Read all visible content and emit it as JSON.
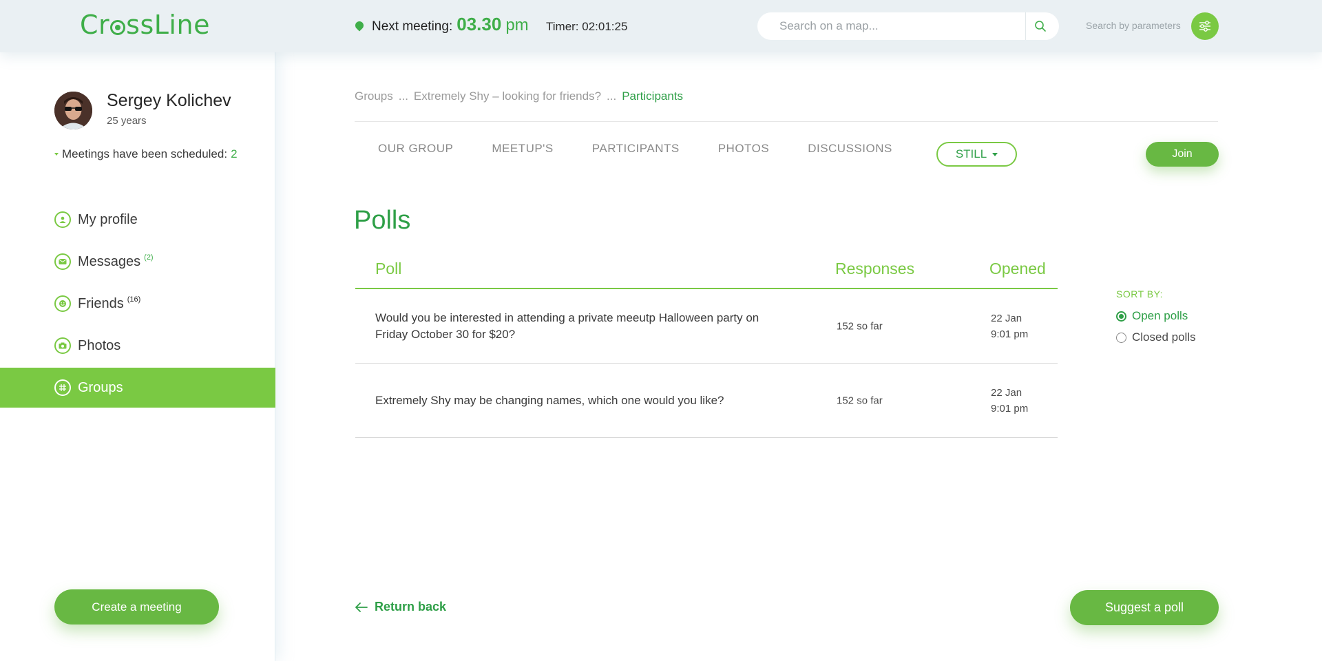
{
  "header": {
    "logo_before": "Cr",
    "logo_after": "ssLine",
    "next_meeting_label": "Next meeting:",
    "next_meeting_time": "03.30",
    "next_meeting_ampm": "pm",
    "timer": "Timer: 02:01:25",
    "search_placeholder": "Search on a map...",
    "search_params_label": "Search by parameters"
  },
  "user": {
    "name": "Sergey Kolichev",
    "age": "25 years",
    "meetings_label": "Meetings have been scheduled:",
    "meetings_count": "2"
  },
  "sidebar": {
    "items": [
      {
        "label": "My profile",
        "icon": "user-icon",
        "badge": ""
      },
      {
        "label": "Messages",
        "icon": "envelope-icon",
        "badge": "(2)"
      },
      {
        "label": "Friends",
        "icon": "smiley-icon",
        "badge": "(16)"
      },
      {
        "label": "Photos",
        "icon": "camera-icon",
        "badge": ""
      },
      {
        "label": "Groups",
        "icon": "grid-icon",
        "badge": "",
        "active": true
      }
    ],
    "create_meeting_label": "Create a meeting"
  },
  "breadcrumb": {
    "items": [
      "Groups",
      "...",
      "Extremely Shy – looking for friends?",
      "..."
    ],
    "current": "Participants"
  },
  "tabs": [
    "OUR GROUP",
    "MEETUP'S",
    "PARTICIPANTS",
    "PHOTOS",
    "DISCUSSIONS"
  ],
  "still_label": "STILL",
  "join_label": "Join",
  "page_title": "Polls",
  "table": {
    "columns": [
      "Poll",
      "Responses",
      "Opened"
    ],
    "rows": [
      {
        "question": "Would you be interested in attending a private meeutp Halloween party on Friday October 30 for $20?",
        "responses": "152 so far",
        "date": "22 Jan",
        "time": "9:01 pm"
      },
      {
        "question": "Extremely Shy may be changing names, which one would you like?",
        "responses": "152 so far",
        "date": "22 Jan",
        "time": "9:01 pm"
      }
    ]
  },
  "sort": {
    "label": "SORT BY:",
    "options": [
      {
        "label": "Open polls",
        "selected": true
      },
      {
        "label": "Closed polls",
        "selected": false
      }
    ]
  },
  "return_back_label": "Return back",
  "suggest_poll_label": "Suggest a poll",
  "colors": {
    "accent": "#7ac943",
    "accent_dark": "#2e9f47",
    "button": "#68b843",
    "header_bg": "#eaf0f3"
  }
}
